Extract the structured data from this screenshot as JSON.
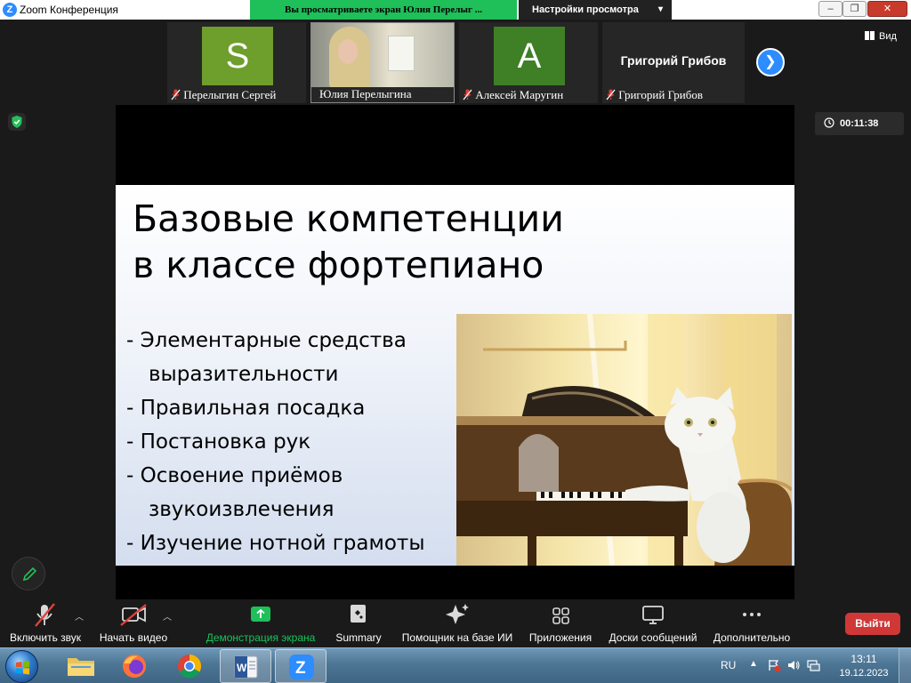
{
  "window": {
    "app_title": "Zoom Конференция",
    "logo_letter": "Z",
    "share_banner": "Вы просматриваете экран Юлия Перелыг ...",
    "view_options": "Настройки просмотра",
    "minimize": "–",
    "maximize": "❐",
    "close": "✕"
  },
  "participants": [
    {
      "avatar_letter": "S",
      "name": "Перелыгин Сергей",
      "muted": true,
      "avatar_color": "#6e9e2c"
    },
    {
      "name": "Юлия Перелыгина",
      "muted": false,
      "has_video": true
    },
    {
      "avatar_letter": "A",
      "name": "Алексей Маругин",
      "muted": true,
      "avatar_color": "#3f7f25"
    },
    {
      "display_name": "Григорий Грибов",
      "name": "Григорий Грибов",
      "muted": true
    }
  ],
  "view_button": "Вид",
  "timer": "00:11:38",
  "slide": {
    "title_line1": "Базовые компетенции",
    "title_line2": "в классе фортепиано",
    "items": [
      "- Элементарные средства",
      "выразительности",
      "- Правильная посадка",
      "- Постановка рук",
      "- Освоение приёмов",
      "звукоизвлечения",
      "- Изучение нотной грамоты"
    ]
  },
  "toolbar": {
    "unmute": "Включить звук",
    "start_video": "Начать видео",
    "share_screen": "Демонстрация экрана",
    "summary": "Summary",
    "ai_companion": "Помощник на базе ИИ",
    "apps": "Приложения",
    "whiteboards": "Доски сообщений",
    "more": "Дополнительно",
    "exit": "Выйти"
  },
  "taskbar": {
    "language": "RU",
    "time": "13:11",
    "date": "19.12.2023"
  },
  "colors": {
    "zoom_blue": "#2d8cff",
    "share_green": "#1fbf5a",
    "exit_red": "#d03838",
    "muted_red": "#e0413a"
  }
}
